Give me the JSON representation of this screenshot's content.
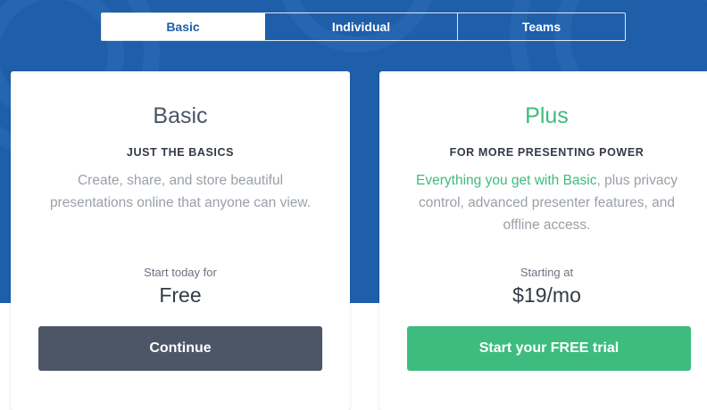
{
  "colors": {
    "hero_blue": "#1f5ea9",
    "accent_green": "#3dbb7d",
    "dark_button": "#4d5666"
  },
  "tabs": [
    {
      "label": "Basic",
      "active": true
    },
    {
      "label": "Individual",
      "active": false
    },
    {
      "label": "Teams",
      "active": false
    }
  ],
  "plans": {
    "basic": {
      "title": "Basic",
      "subtitle": "JUST THE BASICS",
      "description": "Create, share, and store beautiful presentations online that anyone can view.",
      "price_label": "Start today for",
      "price": "Free",
      "cta": "Continue"
    },
    "plus": {
      "title": "Plus",
      "subtitle": "FOR MORE PRESENTING POWER",
      "description_highlight": "Everything you get with Basic",
      "description_rest": ", plus privacy control, advanced presenter features, and offline access.",
      "price_label": "Starting at",
      "price": "$19/mo",
      "cta": "Start your FREE trial"
    }
  }
}
